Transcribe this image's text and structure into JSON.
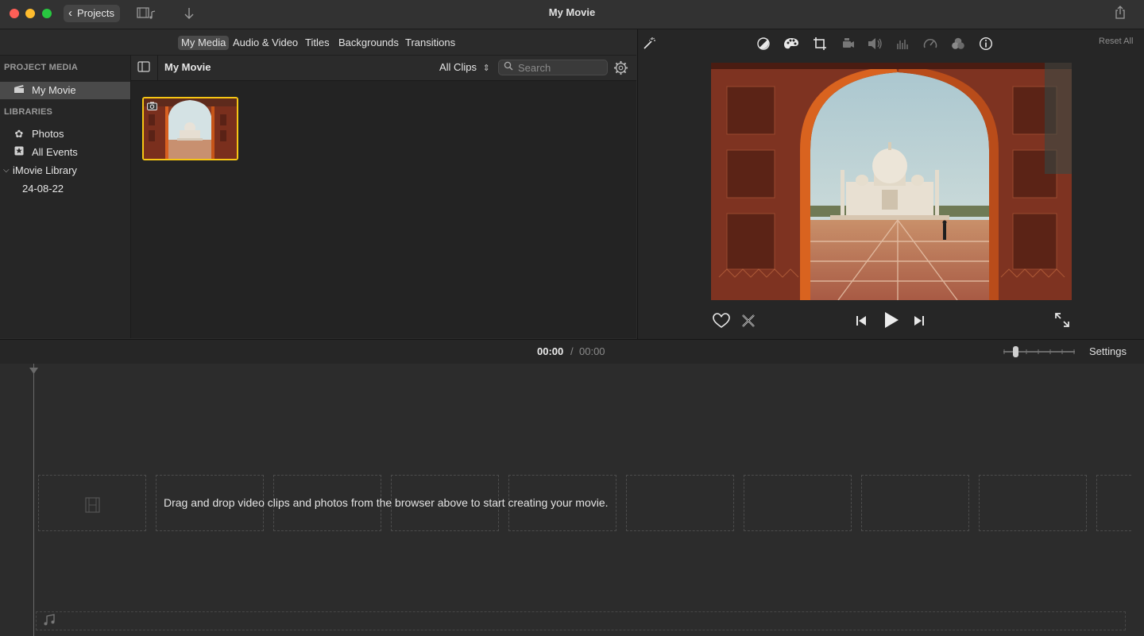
{
  "window": {
    "title": "My Movie",
    "projects_label": "Projects"
  },
  "browser": {
    "tabs": [
      {
        "label": "My Media",
        "active": true
      },
      {
        "label": "Audio & Video",
        "active": false
      },
      {
        "label": "Titles",
        "active": false
      },
      {
        "label": "Backgrounds",
        "active": false
      },
      {
        "label": "Transitions",
        "active": false
      }
    ],
    "project_media_header": "PROJECT MEDIA",
    "project_item": "My Movie",
    "libraries_header": "LIBRARIES",
    "library_items": [
      {
        "label": "Photos",
        "icon": "photos-icon"
      },
      {
        "label": "All Events",
        "icon": "star-icon"
      }
    ],
    "library_name": "iMovie Library",
    "event_name": "24-08-22",
    "media_title": "My Movie",
    "filter_label": "All Clips",
    "search_placeholder": "Search"
  },
  "viewer": {
    "reset_label": "Reset All",
    "tools": [
      "magic-wand-icon",
      "color-balance-icon",
      "color-correction-icon",
      "crop-icon",
      "stabilization-icon",
      "volume-icon",
      "noise-reduction-icon",
      "speed-icon",
      "clip-filter-icon",
      "info-icon"
    ]
  },
  "timecode": {
    "current": "00:00",
    "separator": "/",
    "total": "00:00"
  },
  "settings_label": "Settings",
  "timeline": {
    "placeholder": "Drag and drop video clips and photos from the browser above to start creating your movie."
  },
  "colors": {
    "selection": "#f7c614",
    "accent": "#2f7bf6"
  }
}
